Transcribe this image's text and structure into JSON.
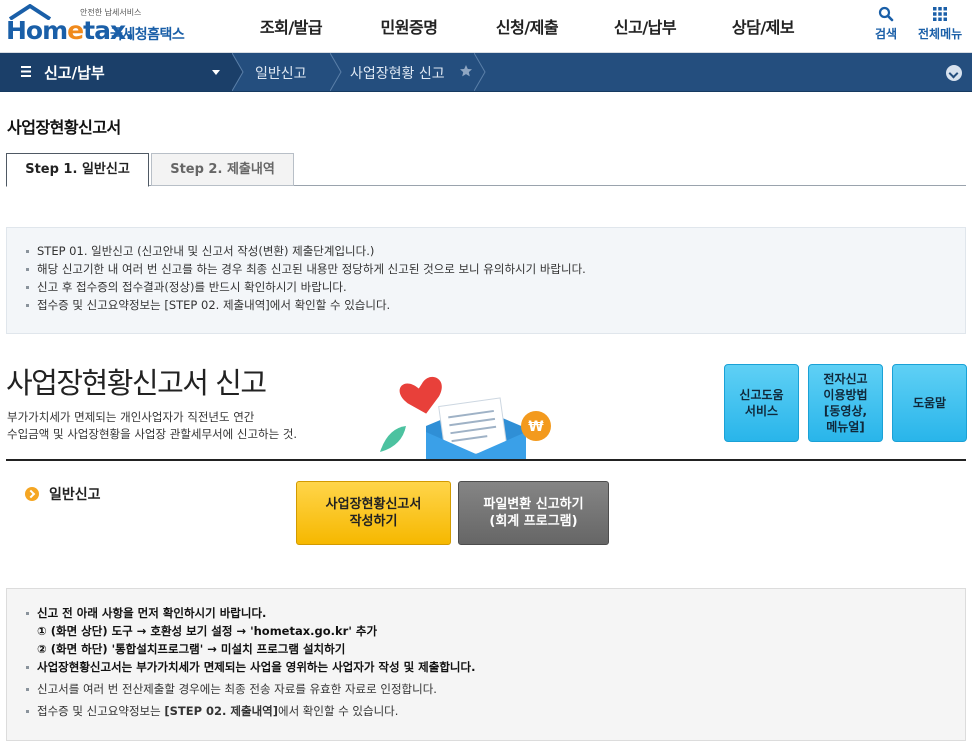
{
  "header": {
    "logo_small": "안전한 납세서비스",
    "logo_text_1": "Hom",
    "logo_text_e": "e",
    "logo_text_2": "tax.",
    "logo_kor": "국세청홈택스",
    "menu": [
      "조회/발급",
      "민원증명",
      "신청/제출",
      "신고/납부",
      "상담/제보"
    ],
    "search_label": "검색",
    "all_menu_label": "전체메뉴"
  },
  "breadcrumb": {
    "first": "신고/납부",
    "items": [
      "일반신고",
      "사업장현황 신고"
    ]
  },
  "page": {
    "title": "사업장현황신고서",
    "tabs": [
      {
        "label": "Step 1. 일반신고",
        "active": true
      },
      {
        "label": "Step 2. 제출내역",
        "active": false
      }
    ]
  },
  "info": [
    "STEP 01. 일반신고 (신고안내 및 신고서 작성(변환) 제출단계입니다.)",
    "해당 신고기한 내 여러 번 신고를 하는 경우 최종 신고된 내용만 정당하게 신고된 것으로 보니 유의하시기 바랍니다.",
    "신고 후 접수증의 접수결과(정상)를 반드시 확인하시기 바랍니다.",
    "접수증 및 신고요약정보는 [STEP 02. 제출내역]에서 확인할 수 있습니다."
  ],
  "hero": {
    "title": "사업장현황신고서 신고",
    "desc_line1": "부가가치세가 면제되는 개인사업자가 직전년도 연간",
    "desc_line2": "수입금액 및 사업장현황을 사업장 관할세무서에 신고하는 것.",
    "buttons": [
      {
        "line1": "신고도움",
        "line2": "서비스"
      },
      {
        "line1": "전자신고",
        "line2": "이용방법",
        "line3": "[동영상,",
        "line4": "메뉴얼]"
      },
      {
        "line1": "도움말"
      }
    ]
  },
  "general": {
    "label": "일반신고",
    "btn_write_line1": "사업장현황신고서",
    "btn_write_line2": "작성하기",
    "btn_convert_line1": "파일변환 신고하기",
    "btn_convert_line2": "(회계 프로그램)"
  },
  "notice": {
    "head": "신고 전 아래 사항을 먼저 확인하시기 바랍니다.",
    "step1": "① (화면 상단) 도구 → 호환성 보기 설정 → 'hometax.go.kr' 추가",
    "step2": "② (화면 하단) '통합설치프로그램' → 미설치 프로그램 설치하기",
    "line3": "사업장현황신고서는 부가가치세가 면제되는 사업을 영위하는 사업자가 작성 및 제출합니다.",
    "line4": "신고서를 여러 번 전산제출할 경우에는 최종 전송 자료를 유효한 자료로 인정합니다.",
    "line5_pre": "접수증 및 신고요약정보는 ",
    "line5_bold": "[STEP 02. 제출내역]",
    "line5_post": "에서 확인할 수 있습니다."
  }
}
